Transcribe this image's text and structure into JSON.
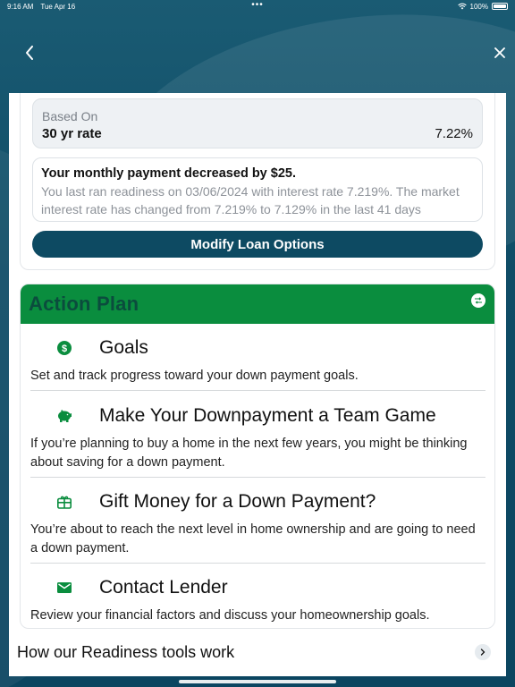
{
  "status_bar": {
    "time": "9:16 AM",
    "date": "Tue Apr 16",
    "battery": "100%"
  },
  "based_on": {
    "label": "Based On",
    "term": "30 yr rate",
    "rate": "7.22%"
  },
  "payment": {
    "headline": "Your monthly payment decreased by $25.",
    "detail": "You last ran readiness on 03/06/2024 with interest rate 7.219%. The market interest rate has changed from 7.219% to 7.129% in the last 41 days"
  },
  "modify_button": "Modify Loan Options",
  "action_plan": {
    "title": "Action Plan",
    "items": [
      {
        "icon": "dollar-icon",
        "title": "Goals",
        "desc": "Set and track progress toward your down payment goals."
      },
      {
        "icon": "piggy-bank-icon",
        "title": "Make Your Downpayment a Team Game",
        "desc": "If you’re planning to buy a home in the next few years, you might be thinking about saving for a down payment."
      },
      {
        "icon": "gift-card-icon",
        "title": "Gift Money for a Down Payment?",
        "desc": "You’re about to reach the next level in home ownership and are going to need a down payment."
      },
      {
        "icon": "mail-icon",
        "title": "Contact Lender",
        "desc": "Review your financial factors and discuss your homeownership goals."
      }
    ]
  },
  "readiness_link": "How our Readiness tools work",
  "colors": {
    "brand_dark": "#0d4a62",
    "action_green": "#0a8d3e",
    "icon_green": "#0a8d3e"
  }
}
